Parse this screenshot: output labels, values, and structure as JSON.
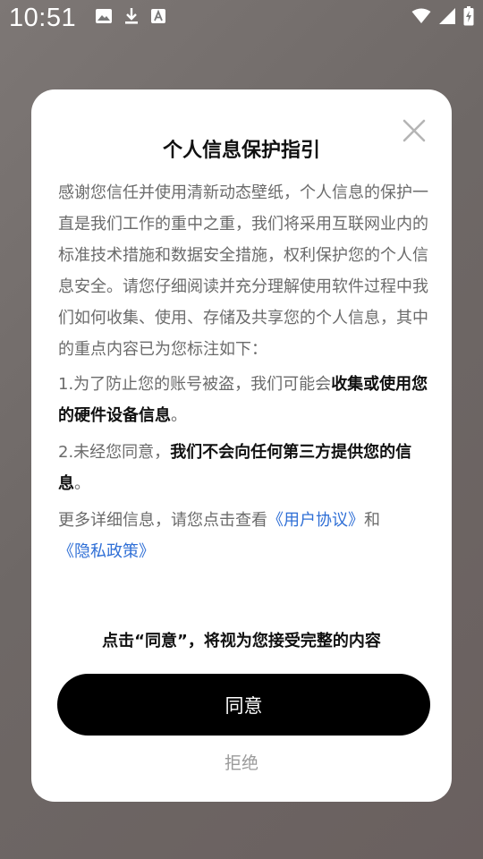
{
  "status_bar": {
    "time": "10:51",
    "left_icons": [
      "image-icon",
      "download-icon",
      "translate-icon"
    ],
    "right_icons": [
      "wifi-icon",
      "signal-icon",
      "battery-icon"
    ]
  },
  "dialog": {
    "title": "个人信息保护指引",
    "intro": "感谢您信任并使用清新动态壁纸，个人信息的保护一直是我们工作的重中之重，我们将采用互联网业内的标准技术措施和数据安全措施，权利保护您的个人信息安全。请您仔细阅读并充分理解使用软件过程中我们如何收集、使用、存储及共享您的个人信息，其中的重点内容已为您标注如下：",
    "item1": {
      "prefix": "1.为了防止您的账号被盗，我们可能会",
      "bold": "收集或使用您的硬件设备信息",
      "suffix": "。"
    },
    "item2": {
      "prefix": "2.未经您同意，",
      "bold": "我们不会向任何第三方提供您的信息",
      "suffix": "。"
    },
    "more_info": {
      "text": "更多详细信息，请您点击查看",
      "user_agreement_link": "《用户协议》",
      "and": "和",
      "privacy_policy_link": "《隐私政策》"
    },
    "confirm_note": "点击“同意”，将视为您接受完整的内容",
    "agree_button": "同意",
    "reject_button": "拒绝"
  },
  "colors": {
    "backdrop": "#6f6866",
    "dialog_bg": "#ffffff",
    "body_text": "#6b6b6b",
    "emphasis_text": "#111111",
    "link": "#2f6fd6",
    "agree_button_bg": "#000000",
    "reject_text": "#9a9a9a"
  }
}
